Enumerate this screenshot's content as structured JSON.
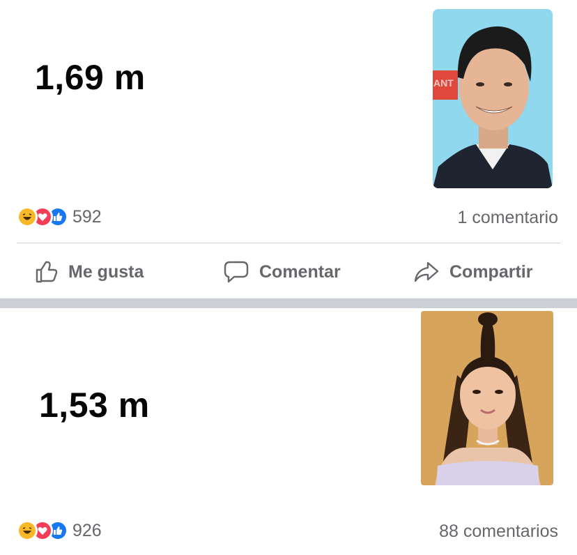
{
  "posts": [
    {
      "text": "1,69 m",
      "photo": "man-portrait",
      "reaction_icons": [
        "haha",
        "love",
        "like"
      ],
      "reaction_count": "592",
      "comment_count": "1 comentario"
    },
    {
      "text": "1,53 m",
      "photo": "woman-portrait",
      "reaction_icons": [
        "haha",
        "love",
        "like"
      ],
      "reaction_count": "926",
      "comment_count": "88 comentarios"
    }
  ],
  "actions": {
    "like_label": "Me gusta",
    "comment_label": "Comentar",
    "share_label": "Compartir"
  },
  "photo_text": "ANT",
  "colors": {
    "haha": "#f7b928",
    "love": "#f33e58",
    "like": "#1877f2",
    "meta_text": "#65676b",
    "separator": "#ccd0d5"
  }
}
